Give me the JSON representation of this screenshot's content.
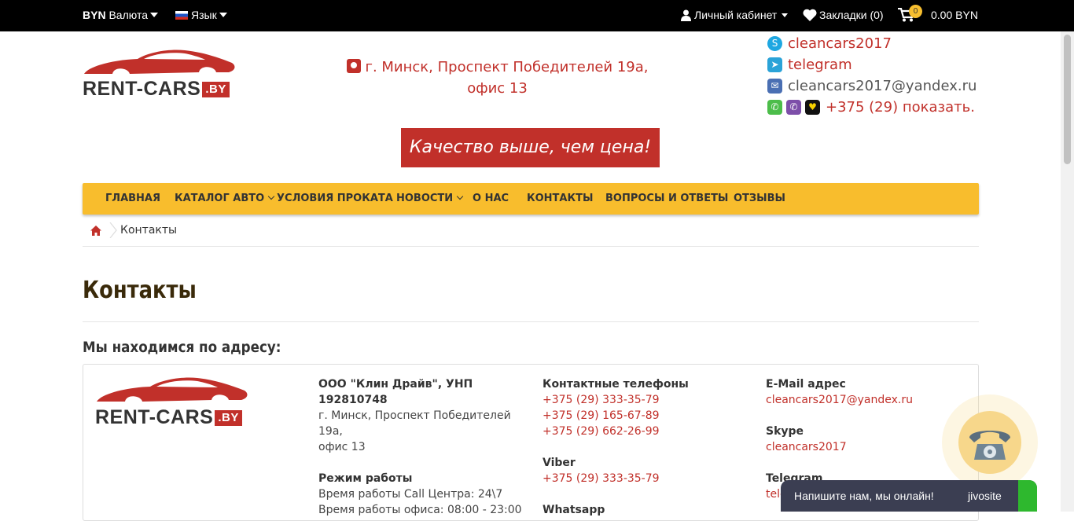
{
  "topbar": {
    "currency_code": "BYN",
    "currency_label": "Валюта",
    "language_label": "Язык",
    "account_label": "Личный кабинет",
    "bookmarks_label": "Закладки (0)",
    "cart_count": "0",
    "cart_total": "0.00 BYN"
  },
  "header": {
    "logo_text": "RENT-CARS",
    "logo_tld": ".BY",
    "address_line1": "г. Минск, Проспект Победителей 19а,",
    "address_line2": "офис 13",
    "skype": "cleancars2017",
    "telegram": "telegram",
    "email": "cleancars2017@yandex.ru",
    "phone": "+375 (29) показать.",
    "slogan": "Качество выше, чем цена!"
  },
  "nav": {
    "items": [
      {
        "label": "ГЛАВНАЯ"
      },
      {
        "label": "КАТАЛОГ АВТО"
      },
      {
        "label": "УСЛОВИЯ ПРОКАТА"
      },
      {
        "label": "НОВОСТИ"
      },
      {
        "label": "О НАС"
      },
      {
        "label": "КОНТАКТЫ"
      },
      {
        "label": "ВОПРОСЫ И ОТВЕТЫ"
      },
      {
        "label": "ОТЗЫВЫ"
      }
    ]
  },
  "breadcrumb": {
    "current": "Контакты"
  },
  "main": {
    "title": "Контакты",
    "subtitle": "Мы находимся по адресу:",
    "company": "ООО \"Клин Драйв\", УНП 192810748",
    "company_address_1": "г. Минск, Проспект Победителей 19а,",
    "company_address_2": "офис 13",
    "hours_title": "Режим работы",
    "hours_call": "Время работы Call Центра: 24\\7",
    "hours_office": "Время работы офиса: 08:00 - 23:00",
    "phones_title": "Контактные телефоны",
    "phones": [
      "+375 (29) 333-35-79",
      "+375 (29) 165-67-89",
      "+375 (29) 662-26-99"
    ],
    "viber_title": "Viber",
    "viber_phone": "+375 (29) 333-35-79",
    "whatsapp_title": "Whatsapp",
    "email_title": "E-Mail адрес",
    "email": "cleancars2017@yandex.ru",
    "skype_title": "Skype",
    "skype": "cleancars2017",
    "telegram_title": "Telegram",
    "telegram_partial": "tele"
  },
  "widget": {
    "chat_message": "Напишите нам, мы онлайн!",
    "chat_brand": "jivosite"
  },
  "colors": {
    "accent_red": "#c1302a",
    "nav_yellow": "#f8bd2d",
    "topbar": "#000000"
  }
}
